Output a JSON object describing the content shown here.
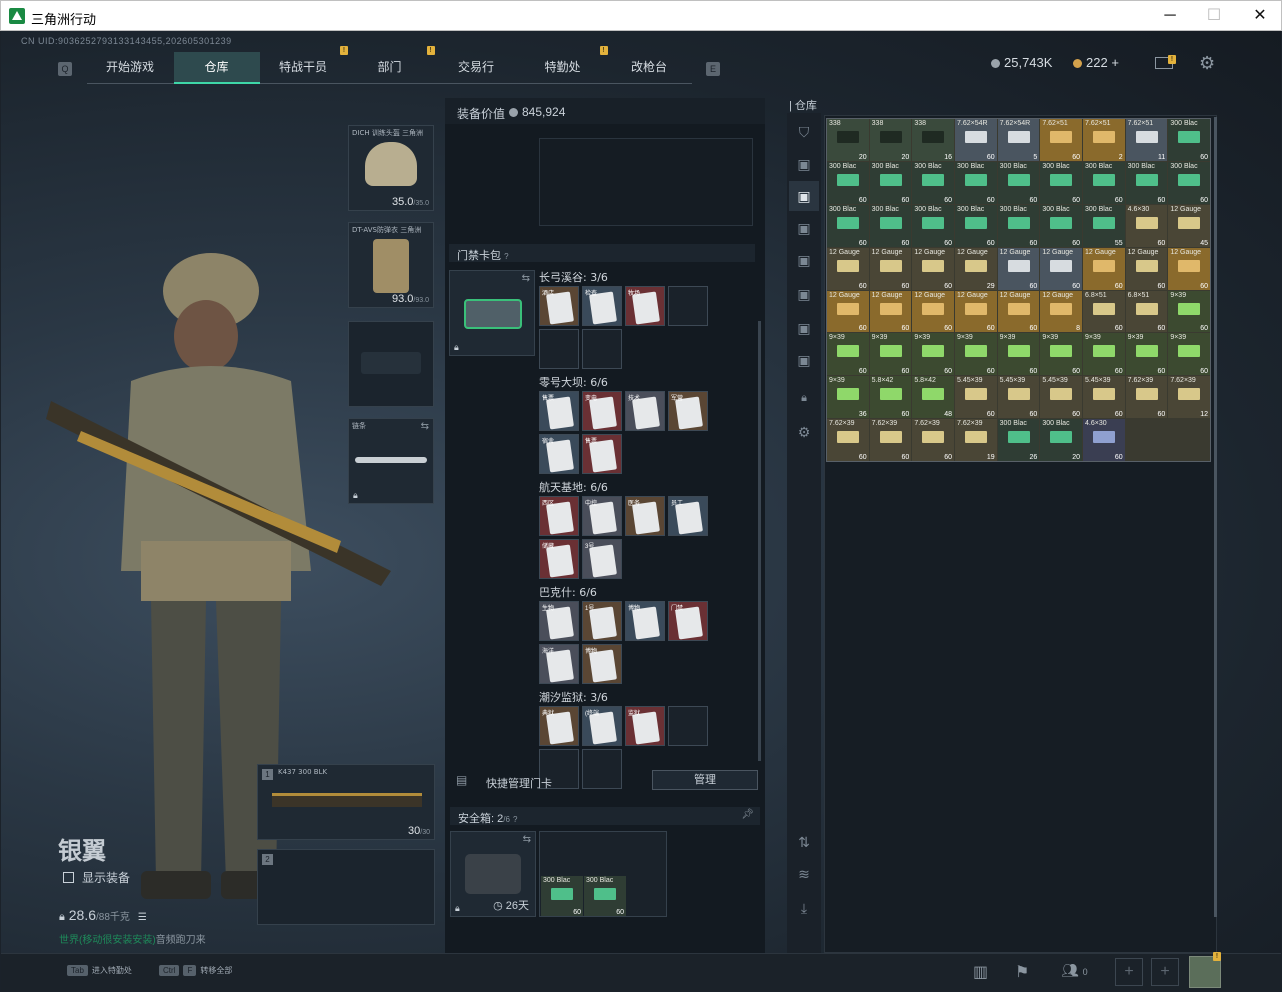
{
  "window": {
    "title": "三角洲行动",
    "minimize": "─",
    "maximize": "☐",
    "close": "✕"
  },
  "uid": "CN UID:9036252793133143455,202605301239",
  "nav": {
    "left_key": "Q",
    "right_key": "E",
    "tabs": [
      {
        "label": "开始游戏",
        "active": false,
        "notif": false
      },
      {
        "label": "仓库",
        "active": true,
        "notif": false
      },
      {
        "label": "特战干员",
        "active": false,
        "notif": true
      },
      {
        "label": "部门",
        "active": false,
        "notif": true
      },
      {
        "label": "交易行",
        "active": false,
        "notif": false
      },
      {
        "label": "特勤处",
        "active": false,
        "notif": true
      },
      {
        "label": "改枪台",
        "active": false,
        "notif": false
      }
    ],
    "notif_mark": "!"
  },
  "currency": {
    "silver": "25,743K",
    "gold": "222",
    "plus": "+"
  },
  "character": {
    "name": "银翼",
    "show_equip": "显示装备",
    "weight": "28.6",
    "weight_max": "/88千克",
    "status_line1": "世界(移动很安装安装)",
    "status_line2": "音频跑刀来"
  },
  "gear": {
    "helmet": {
      "label": "DICH 训练头盔 三角洲",
      "value": "35.0",
      "max": "/35.0"
    },
    "armor": {
      "label": "DT-AVS防弹衣 三角洲",
      "value": "93.0",
      "max": "/93.0"
    },
    "melee": {
      "label": "链条"
    },
    "weapon1": {
      "index": "1",
      "label": "K437 300 BLK",
      "ammo": "30",
      "max": "/30"
    },
    "weapon2": {
      "index": "2"
    }
  },
  "equipment": {
    "title": "装备价值",
    "value": "845,924",
    "keycard_title": "门禁卡包",
    "help": "?",
    "groups": [
      {
        "name": "长弓溪谷: 3/6",
        "cards": [
          "酒店",
          "检查",
          "牧场"
        ]
      },
      {
        "name": "零号大坝: 6/6",
        "cards": [
          "售票",
          "变电",
          "技术",
          "军营",
          "宿舍",
          "售票"
        ]
      },
      {
        "name": "航天基地: 6/6",
        "cards": [
          "西区",
          "中控",
          "医务",
          "员工",
          "储藏",
          "3号"
        ]
      },
      {
        "name": "巴克什: 6/6",
        "cards": [
          "生物",
          "1号",
          "博物",
          "门禁",
          "海洋",
          "博物"
        ]
      },
      {
        "name": "潮汐监狱: 3/6",
        "cards": [
          "典狱",
          "(终端",
          "监狱"
        ]
      }
    ],
    "quick_label": "快捷管理门卡",
    "manage": "管理",
    "safebox": "安全箱:",
    "safebox_count": "2",
    "safebox_max": "/6",
    "safebox_time": "26天",
    "safebox_items": [
      {
        "label": "300 Blac",
        "count": "60"
      },
      {
        "label": "300 Blac",
        "count": "60"
      }
    ]
  },
  "warehouse": {
    "title": "仓库",
    "cells": [
      [
        "338",
        "20",
        "#3a4a3c"
      ],
      [
        "338",
        "20",
        "#3a4a3c"
      ],
      [
        "338",
        "16",
        "#3a4a3c"
      ],
      [
        "7.62×54R",
        "60",
        "#4a5560"
      ],
      [
        "7.62×54R",
        "5",
        "#4a5560"
      ],
      [
        "7.62×51",
        "60",
        "#8a6a2c"
      ],
      [
        "7.62×51",
        "2",
        "#8a6a2c"
      ],
      [
        "7.62×51",
        "11",
        "#4a5560"
      ],
      [
        "300 Blac",
        "60",
        "#2f3d34"
      ],
      [
        "300 Blac",
        "60",
        "#2f3d34"
      ],
      [
        "300 Blac",
        "60",
        "#2f3d34"
      ],
      [
        "300 Blac",
        "60",
        "#2f3d34"
      ],
      [
        "300 Blac",
        "60",
        "#2f3d34"
      ],
      [
        "300 Blac",
        "60",
        "#2f3d34"
      ],
      [
        "300 Blac",
        "60",
        "#2f3d34"
      ],
      [
        "300 Blac",
        "60",
        "#2f3d34"
      ],
      [
        "300 Blac",
        "60",
        "#2f3d34"
      ],
      [
        "300 Blac",
        "60",
        "#2f3d34"
      ],
      [
        "300 Blac",
        "60",
        "#2f3d34"
      ],
      [
        "300 Blac",
        "60",
        "#2f3d34"
      ],
      [
        "300 Blac",
        "60",
        "#2f3d34"
      ],
      [
        "300 Blac",
        "60",
        "#2f3d34"
      ],
      [
        "300 Blac",
        "60",
        "#2f3d34"
      ],
      [
        "300 Blac",
        "60",
        "#2f3d34"
      ],
      [
        "300 Blac",
        "55",
        "#2f3d34"
      ],
      [
        "4.6×30",
        "60",
        "#4a4636"
      ],
      [
        "12 Gauge",
        "45",
        "#4a4636"
      ],
      [
        "12 Gauge",
        "60",
        "#4a4636"
      ],
      [
        "12 Gauge",
        "60",
        "#4a4636"
      ],
      [
        "12 Gauge",
        "60",
        "#4a4636"
      ],
      [
        "12 Gauge",
        "29",
        "#4a4636"
      ],
      [
        "12 Gauge",
        "60",
        "#4a5560"
      ],
      [
        "12 Gauge",
        "60",
        "#4a5560"
      ],
      [
        "12 Gauge",
        "60",
        "#8a6a2c"
      ],
      [
        "12 Gauge",
        "60",
        "#4a4636"
      ],
      [
        "12 Gauge",
        "60",
        "#8a6a2c"
      ],
      [
        "12 Gauge",
        "60",
        "#8a6a2c"
      ],
      [
        "12 Gauge",
        "60",
        "#8a6a2c"
      ],
      [
        "12 Gauge",
        "60",
        "#8a6a2c"
      ],
      [
        "12 Gauge",
        "60",
        "#8a6a2c"
      ],
      [
        "12 Gauge",
        "60",
        "#8a6a2c"
      ],
      [
        "12 Gauge",
        "8",
        "#8a6a2c"
      ],
      [
        "6.8×51",
        "60",
        "#4a4636"
      ],
      [
        "6.8×51",
        "60",
        "#4a4636"
      ],
      [
        "9×39",
        "60",
        "#3c4a30"
      ],
      [
        "9×39",
        "60",
        "#3c4a30"
      ],
      [
        "9×39",
        "60",
        "#3c4a30"
      ],
      [
        "9×39",
        "60",
        "#3c4a30"
      ],
      [
        "9×39",
        "60",
        "#3c4a30"
      ],
      [
        "9×39",
        "60",
        "#3c4a30"
      ],
      [
        "9×39",
        "60",
        "#3c4a30"
      ],
      [
        "9×39",
        "60",
        "#3c4a30"
      ],
      [
        "9×39",
        "60",
        "#3c4a30"
      ],
      [
        "9×39",
        "60",
        "#3c4a30"
      ],
      [
        "9×39",
        "36",
        "#3c4a30"
      ],
      [
        "5.8×42",
        "60",
        "#3c4a30"
      ],
      [
        "5.8×42",
        "48",
        "#3c4a30"
      ],
      [
        "5.45×39",
        "60",
        "#4a4636"
      ],
      [
        "5.45×39",
        "60",
        "#4a4636"
      ],
      [
        "5.45×39",
        "60",
        "#4a4636"
      ],
      [
        "5.45×39",
        "60",
        "#4a4636"
      ],
      [
        "7.62×39",
        "60",
        "#4a4636"
      ],
      [
        "7.62×39",
        "12",
        "#4a4636"
      ],
      [
        "7.62×39",
        "60",
        "#4a4636"
      ],
      [
        "7.62×39",
        "60",
        "#4a4636"
      ],
      [
        "7.62×39",
        "60",
        "#4a4636"
      ],
      [
        "7.62×39",
        "19",
        "#4a4636"
      ],
      [
        "300 Blac",
        "26",
        "#2f3d34"
      ],
      [
        "300 Blac",
        "20",
        "#2f3d34"
      ],
      [
        "4.6×30",
        "60",
        "#3a3e52"
      ]
    ]
  },
  "bottom": {
    "tab_key": "Tab",
    "tab_label": "进入特勤处",
    "ctrl_key": "Ctrl",
    "f_key": "F",
    "ctrl_label": "转移全部",
    "count": "0"
  }
}
